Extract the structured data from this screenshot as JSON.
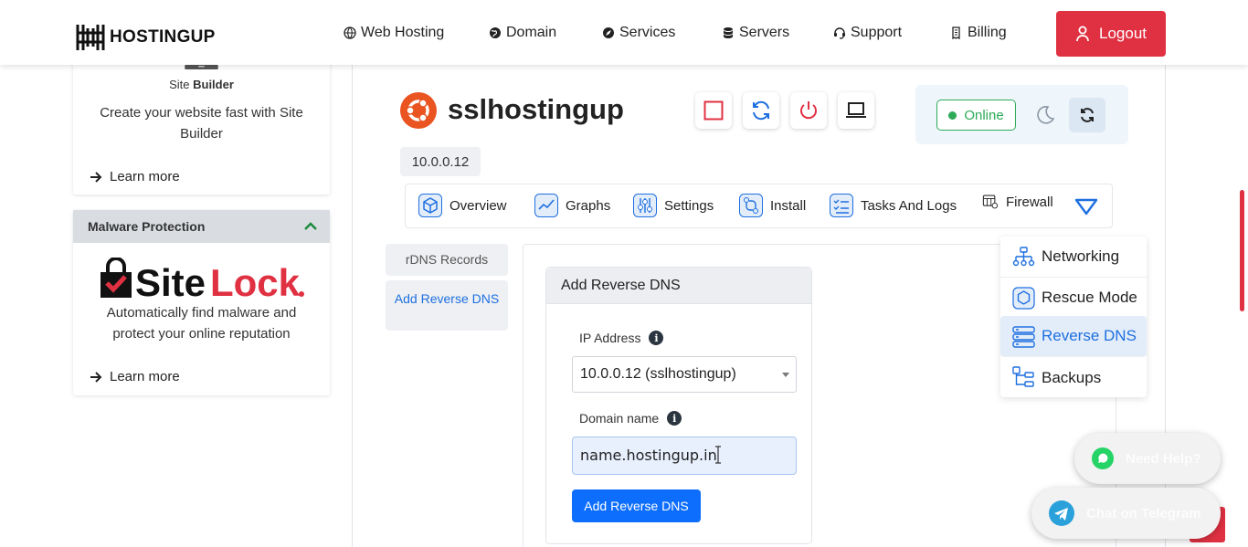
{
  "header": {
    "logo_text": "HOSTINGUP",
    "nav": [
      {
        "label": "Web Hosting",
        "icon": "globe-icon"
      },
      {
        "label": "Domain",
        "icon": "world-icon"
      },
      {
        "label": "Services",
        "icon": "compass-icon"
      },
      {
        "label": "Servers",
        "icon": "database-icon"
      },
      {
        "label": "Support",
        "icon": "headset-icon"
      },
      {
        "label": "Billing",
        "icon": "receipt-icon"
      }
    ],
    "logout_label": "Logout"
  },
  "sidebar": {
    "site_builder": {
      "label_prefix": "Site ",
      "label_bold": "Builder",
      "description": "Create your website fast with Site Builder",
      "learn_more": "Learn more"
    },
    "malware": {
      "title": "Malware Protection",
      "logo_text": "SiteLock",
      "description": "Automatically find malware and protect your online reputation",
      "learn_more": "Learn more"
    }
  },
  "server": {
    "name": "sslhostingup",
    "ip": "10.0.0.12",
    "status": "Online",
    "colors": {
      "online": "#2dab58",
      "accent": "#1e6fe0",
      "danger": "#e03142"
    }
  },
  "tabs": [
    {
      "label": "Overview",
      "icon": "cube-icon"
    },
    {
      "label": "Graphs",
      "icon": "chart-line-icon"
    },
    {
      "label": "Settings",
      "icon": "sliders-icon"
    },
    {
      "label": "Install",
      "icon": "route-icon"
    },
    {
      "label": "Tasks And Logs",
      "icon": "checklist-icon"
    },
    {
      "label": "Firewall",
      "icon": "firewall-icon"
    }
  ],
  "dropdown": [
    {
      "label": "Networking",
      "icon": "network-icon"
    },
    {
      "label": "Rescue Mode",
      "icon": "rescue-icon"
    },
    {
      "label": "Reverse DNS",
      "icon": "server-icon",
      "active": true
    },
    {
      "label": "Backups",
      "icon": "backups-icon"
    }
  ],
  "subnav": {
    "records": "rDNS Records",
    "add": "Add Reverse DNS"
  },
  "form": {
    "title": "Add Reverse DNS",
    "ip_label": "IP Address",
    "ip_value": "10.0.0.12 (sslhostingup)",
    "domain_label": "Domain name",
    "domain_value": "name.hostingup.in",
    "submit": "Add Reverse DNS"
  },
  "floating": {
    "help": "Need Help?",
    "telegram": "Chat on Telegram"
  }
}
